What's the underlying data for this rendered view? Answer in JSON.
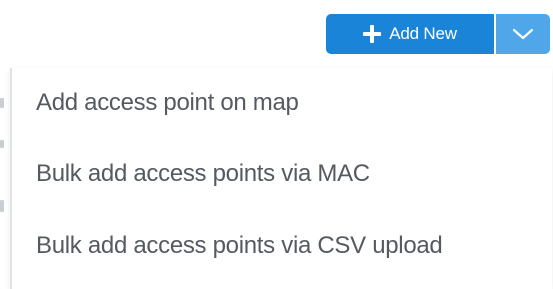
{
  "toolbar": {
    "add_new_label": "Add New",
    "add_new_icon": "plus-icon",
    "toggle_icon": "chevron-down-icon",
    "colors": {
      "primary": "#1a85d8",
      "toggle": "#4fa7ea",
      "menu_text": "#555a61"
    }
  },
  "menu": {
    "items": [
      {
        "label": "Add access point on map"
      },
      {
        "label": "Bulk add access points via MAC"
      },
      {
        "label": "Bulk add access points via CSV upload"
      }
    ]
  }
}
